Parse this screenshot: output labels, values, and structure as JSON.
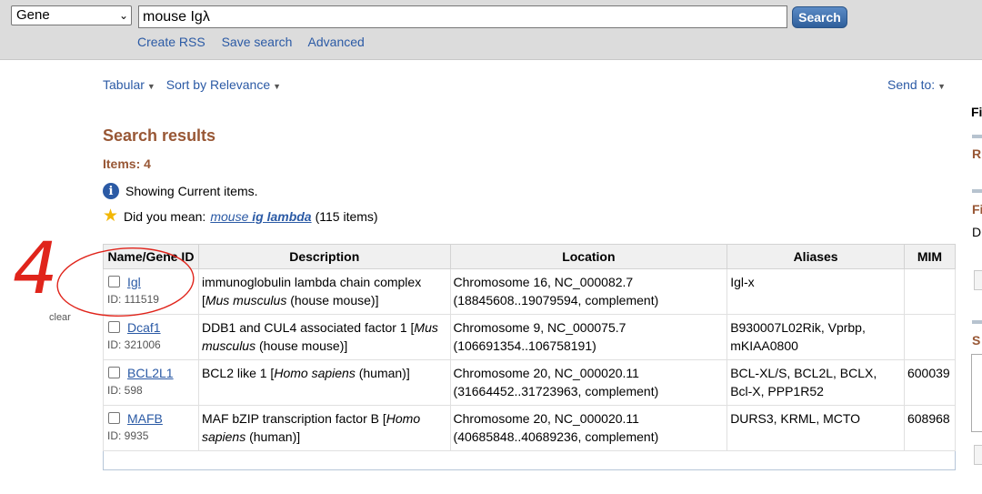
{
  "search": {
    "database": "Gene",
    "query": "mouse Igλ",
    "button": "Search",
    "links": [
      "Create RSS",
      "Save search",
      "Advanced"
    ]
  },
  "toolbar": {
    "format": "Tabular",
    "sort": "Sort by Relevance",
    "send_to": "Send to:"
  },
  "results": {
    "title": "Search results",
    "items": "Items: 4",
    "showing": "Showing Current items.",
    "did_you_mean_prefix": "Did you mean:",
    "did_you_mean_link_a": "mouse ",
    "did_you_mean_link_b": "ig lambda",
    "did_you_mean_suffix": "(115 items)",
    "clear": "clear"
  },
  "table": {
    "headers": [
      "Name/Gene ID",
      "Description",
      "Location",
      "Aliases",
      "MIM"
    ],
    "rows": [
      {
        "name": "Igl",
        "id": "ID: 111519",
        "desc": "immunoglobulin lambda chain complex [",
        "species": "Mus musculus",
        "common": " (house mouse)]",
        "loc1": "Chromosome 16, NC_000082.7",
        "loc2": "(18845608..19079594, complement)",
        "aliases": "Igl-x",
        "mim": ""
      },
      {
        "name": "Dcaf1",
        "id": "ID: 321006",
        "desc": "DDB1 and CUL4 associated factor 1 [",
        "species": "Mus musculus",
        "common": " (house mouse)]",
        "loc1": "Chromosome 9, NC_000075.7",
        "loc2": "(106691354..106758191)",
        "aliases": "B930007L02Rik, Vprbp, mKIAA0800",
        "mim": ""
      },
      {
        "name": "BCL2L1",
        "id": "ID: 598",
        "desc": "BCL2 like 1 [",
        "species": "Homo sapiens",
        "common": " (human)]",
        "loc1": "Chromosome 20, NC_000020.11",
        "loc2": "(31664452..31723963, complement)",
        "aliases": "BCL-XL/S, BCL2L, BCLX, Bcl-X, PPP1R52",
        "mim": "600039"
      },
      {
        "name": "MAFB",
        "id": "ID: 9935",
        "desc": "MAF bZIP transcription factor B [",
        "species": "Homo sapiens",
        "common": " (human)]",
        "loc1": "Chromosome 20, NC_000020.11",
        "loc2": "(40685848..40689236, complement)",
        "aliases": "DURS3, KRML, MCTO",
        "mim": "608968"
      }
    ]
  },
  "sidebar_fragments": [
    "Fi",
    "R",
    "Fi",
    "D",
    "S"
  ],
  "annotation": {
    "number": "4",
    "color": "#e0241b"
  },
  "colors": {
    "link": "#2b5aa5",
    "heading": "#985735",
    "topbar": "#dcdcdc"
  }
}
